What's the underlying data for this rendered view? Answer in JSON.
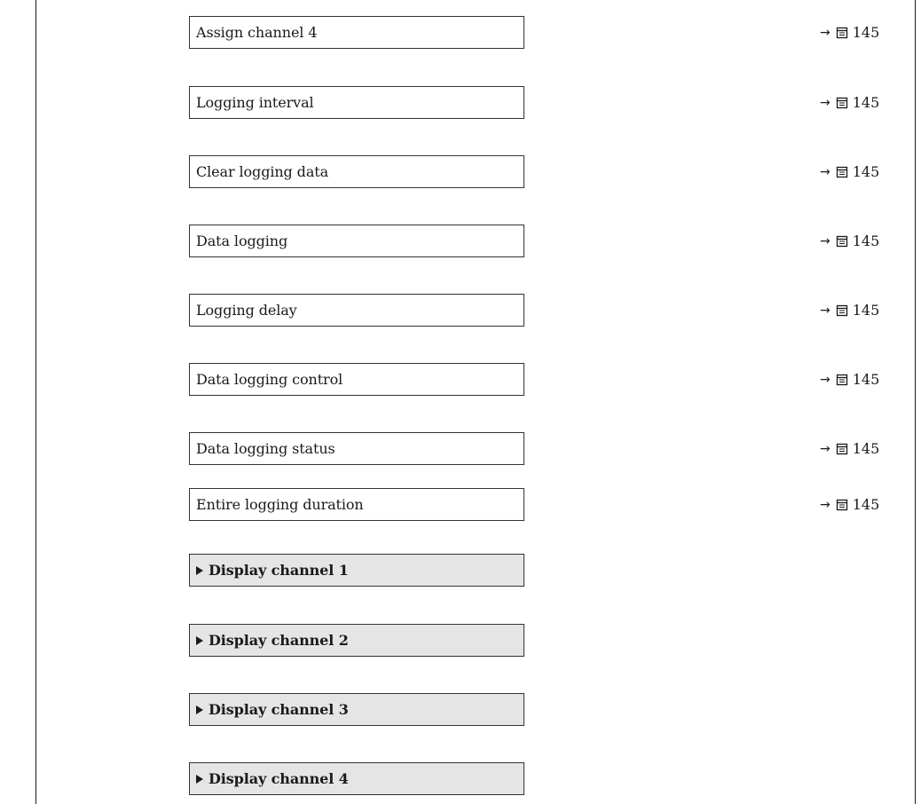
{
  "rows": [
    {
      "label": "Assign channel 4",
      "type": "parameter",
      "page": "145"
    },
    {
      "label": "Logging interval",
      "type": "parameter",
      "page": "145"
    },
    {
      "label": "Clear logging data",
      "type": "parameter",
      "page": "145"
    },
    {
      "label": "Data logging",
      "type": "parameter",
      "page": "145"
    },
    {
      "label": "Logging delay",
      "type": "parameter",
      "page": "145"
    },
    {
      "label": "Data logging control",
      "type": "parameter",
      "page": "145"
    },
    {
      "label": "Data logging status",
      "type": "parameter",
      "page": "145"
    },
    {
      "label": "Entire logging duration",
      "type": "parameter",
      "page": "145"
    },
    {
      "label": "Display channel 1",
      "type": "submenu"
    },
    {
      "label": "Display channel 2",
      "type": "submenu"
    },
    {
      "label": "Display channel 3",
      "type": "submenu"
    },
    {
      "label": "Display channel 4",
      "type": "submenu"
    }
  ],
  "icons": {
    "reference_arrow": "right-arrow-icon",
    "page_reference": "book-icon",
    "submenu_marker": "triangle-right-icon"
  }
}
